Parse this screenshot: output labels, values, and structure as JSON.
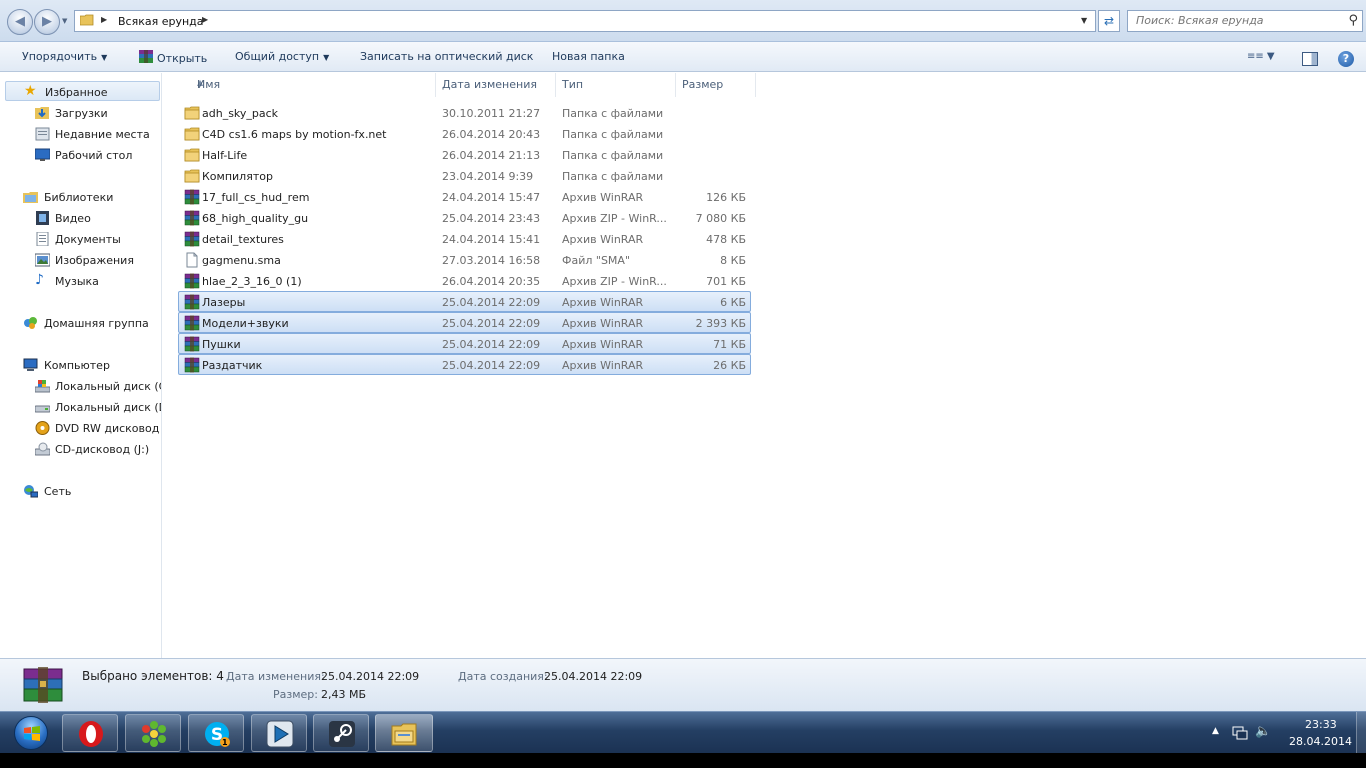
{
  "address": {
    "crumb": "Всякая ерунда",
    "search_placeholder": "Поиск: Всякая ерунда"
  },
  "toolbar": {
    "organize": "Упорядочить",
    "open": "Открыть",
    "share": "Общий доступ",
    "burn": "Записать на оптический диск",
    "new_folder": "Новая папка"
  },
  "sidebar": {
    "favorites": "Избранное",
    "downloads": "Загрузки",
    "recent": "Недавние места",
    "desktop": "Рабочий стол",
    "libraries": "Библиотеки",
    "video": "Видео",
    "documents": "Документы",
    "pictures": "Изображения",
    "music": "Музыка",
    "homegroup": "Домашняя группа",
    "computer": "Компьютер",
    "disk_c": "Локальный диск (C",
    "disk_d": "Локальный диск (D",
    "dvd": "DVD RW дисковод (",
    "cd": "CD-дисковод (J:)",
    "network": "Сеть"
  },
  "columns": {
    "name": "Имя",
    "date": "Дата изменения",
    "type": "Тип",
    "size": "Размер"
  },
  "files": [
    {
      "name": "adh_sky_pack",
      "date": "30.10.2011 21:27",
      "type": "Папка с файлами",
      "size": "",
      "icon": "folder-icon",
      "selected": false
    },
    {
      "name": "C4D cs1.6 maps by motion-fx.net",
      "date": "26.04.2014 20:43",
      "type": "Папка с файлами",
      "size": "",
      "icon": "folder-icon",
      "selected": false
    },
    {
      "name": "Half-Life",
      "date": "26.04.2014 21:13",
      "type": "Папка с файлами",
      "size": "",
      "icon": "folder-icon",
      "selected": false
    },
    {
      "name": "Компилятор",
      "date": "23.04.2014 9:39",
      "type": "Папка с файлами",
      "size": "",
      "icon": "folder-icon",
      "selected": false
    },
    {
      "name": "17_full_cs_hud_rem",
      "date": "24.04.2014 15:47",
      "type": "Архив WinRAR",
      "size": "126 КБ",
      "icon": "winrar-icon",
      "selected": false
    },
    {
      "name": "68_high_quality_gu",
      "date": "25.04.2014 23:43",
      "type": "Архив ZIP - WinR...",
      "size": "7 080 КБ",
      "icon": "winrar-icon",
      "selected": false
    },
    {
      "name": "detail_textures",
      "date": "24.04.2014 15:41",
      "type": "Архив WinRAR",
      "size": "478 КБ",
      "icon": "winrar-icon",
      "selected": false
    },
    {
      "name": "gagmenu.sma",
      "date": "27.03.2014 16:58",
      "type": "Файл \"SMA\"",
      "size": "8 КБ",
      "icon": "file-icon",
      "selected": false
    },
    {
      "name": "hlae_2_3_16_0 (1)",
      "date": "26.04.2014 20:35",
      "type": "Архив ZIP - WinR...",
      "size": "701 КБ",
      "icon": "winrar-icon",
      "selected": false
    },
    {
      "name": "Лазеры",
      "date": "25.04.2014 22:09",
      "type": "Архив WinRAR",
      "size": "6 КБ",
      "icon": "winrar-icon",
      "selected": true
    },
    {
      "name": "Модели+звуки",
      "date": "25.04.2014 22:09",
      "type": "Архив WinRAR",
      "size": "2 393 КБ",
      "icon": "winrar-icon",
      "selected": true
    },
    {
      "name": "Пушки",
      "date": "25.04.2014 22:09",
      "type": "Архив WinRAR",
      "size": "71 КБ",
      "icon": "winrar-icon",
      "selected": true
    },
    {
      "name": "Раздатчик",
      "date": "25.04.2014 22:09",
      "type": "Архив WinRAR",
      "size": "26 КБ",
      "icon": "winrar-icon",
      "selected": true
    }
  ],
  "details": {
    "selected": "Выбрано элементов: 4",
    "modified_label": "Дата изменения:",
    "modified_value": "25.04.2014 22:09",
    "size_label": "Размер:",
    "size_value": "2,43 МБ",
    "created_label": "Дата создания:",
    "created_value": "25.04.2014 22:09"
  },
  "taskbar": {
    "apps": [
      "opera-icon",
      "icq-icon",
      "skype-icon",
      "media-player-icon",
      "steam-icon",
      "explorer-icon"
    ],
    "skype_badge": "1",
    "time": "23:33",
    "date": "28.04.2014"
  }
}
